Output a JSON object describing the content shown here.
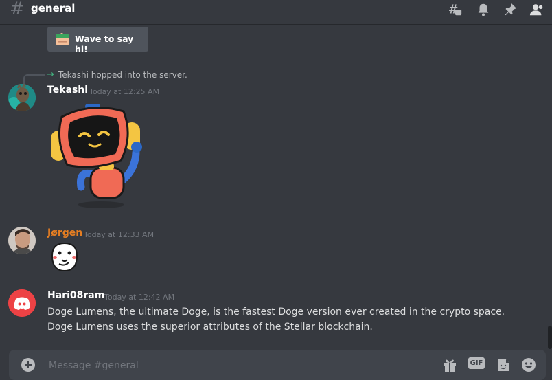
{
  "header": {
    "channel_name": "general",
    "icons": [
      "threads-icon",
      "bell-icon",
      "pin-icon",
      "members-icon"
    ]
  },
  "wave": {
    "label": "Wave to say hi!",
    "icon": "waving-hand-icon"
  },
  "system_message": {
    "text": "Tekashi hopped into the server."
  },
  "messages": [
    {
      "username": "Tekashi",
      "timestamp": "Today at 12:25 AM",
      "user_color": "#ffffff",
      "content_type": "robot-sticker"
    },
    {
      "username": "Jørgen",
      "timestamp": "Today at 12:33 AM",
      "user_color": "#e67e22",
      "content_type": "blob-sticker"
    },
    {
      "username": "Hari08ram",
      "timestamp": "Today at 12:42 AM",
      "user_color": "#ffffff",
      "text": "Doge Lumens, the ultimate Doge, is the fastest Doge version ever created in the crypto space. Doge Lumens uses the superior attributes of the Stellar blockchain."
    }
  ],
  "composer": {
    "placeholder": "Message #general",
    "gif_label": "GIF",
    "icons": [
      "add-icon",
      "gift-icon",
      "gif-icon",
      "sticker-icon",
      "emoji-icon"
    ]
  },
  "colors": {
    "background": "#36393f",
    "composer": "#40444b",
    "accent_green": "#43b581",
    "discord_red": "#ed4245"
  }
}
